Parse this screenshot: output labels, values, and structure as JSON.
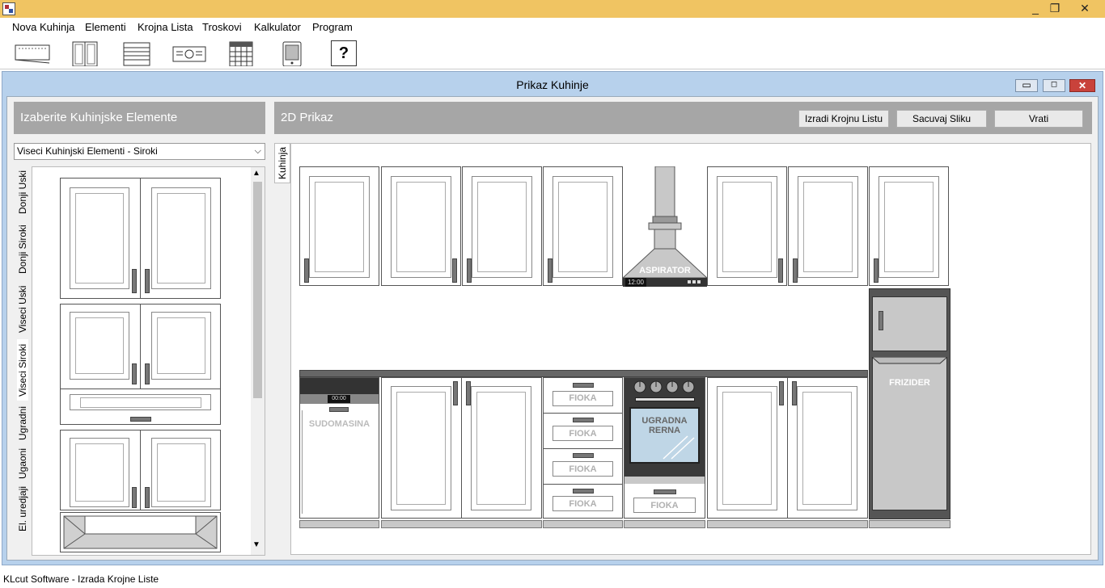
{
  "window": {
    "controls": [
      "_",
      "❐",
      "✕"
    ]
  },
  "menu": [
    "Nova Kuhinja",
    "Elementi",
    "Krojna Lista",
    "Troskovi",
    "Kalkulator",
    "Program"
  ],
  "toolbar": {
    "help_label": "?"
  },
  "child_window": {
    "title": "Prikaz Kuhinje"
  },
  "left_panel": {
    "title": "Izaberite Kuhinjske Elemente",
    "dropdown_value": "Viseci Kuhinjski Elementi - Siroki",
    "tabs": [
      "Donji Uski",
      "Donji Siroki",
      "Viseci Uski",
      "Viseci Siroki",
      "Ugradni",
      "Ugaoni",
      "El. uredjaji"
    ]
  },
  "right_panel": {
    "title": "2D Prikaz",
    "buttons": {
      "create": "Izradi Krojnu Listu",
      "save": "Sacuvaj Sliku",
      "back": "Vrati"
    },
    "tab": "Kuhinja"
  },
  "kitchen": {
    "hood_label": "ASPIRATOR",
    "hood_clock": "12:00",
    "dishwasher_label": "SUDOMASINA",
    "dishwasher_clock": "00:00",
    "oven_label_1": "UGRADNA",
    "oven_label_2": "RERNA",
    "fridge_label": "FRIZIDER",
    "drawer_label": "FIOKA"
  },
  "status": {
    "text": "KLcut Software - Izrada Krojne Liste"
  },
  "colors": {
    "titlebar": "#f0c462",
    "child_frame": "#b7d1ec",
    "panel_header": "#a6a6a6",
    "close_button": "#c9423b"
  }
}
